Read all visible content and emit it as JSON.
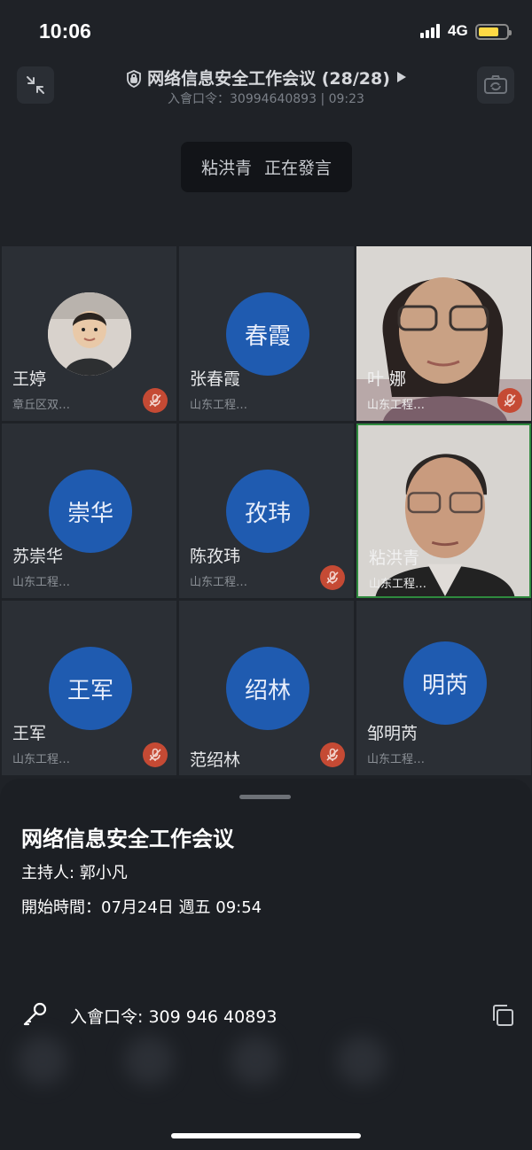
{
  "status_bar": {
    "time": "10:06",
    "network": "4G"
  },
  "header": {
    "title": "网络信息安全工作会议 (28/28)",
    "subtitle": "入會口令：30994640893 | 09:23",
    "speaking_name": "粘洪青",
    "speaking_status": "正在發言"
  },
  "participants": [
    {
      "name": "王婷",
      "org": "章丘区双…",
      "avatar_text": "",
      "muted": true,
      "video": false
    },
    {
      "name": "张春霞",
      "org": "山东工程…",
      "avatar_text": "春霞",
      "muted": false,
      "video": false
    },
    {
      "name": "叶 娜",
      "org": "山东工程…",
      "avatar_text": "",
      "muted": true,
      "video": true
    },
    {
      "name": "苏崇华",
      "org": "山东工程…",
      "avatar_text": "崇华",
      "muted": false,
      "video": false
    },
    {
      "name": "陈孜玮",
      "org": "山东工程…",
      "avatar_text": "孜玮",
      "muted": true,
      "video": false
    },
    {
      "name": "粘洪青",
      "org": "山东工程…",
      "avatar_text": "",
      "muted": false,
      "video": true
    },
    {
      "name": "王军",
      "org": "山东工程…",
      "avatar_text": "王军",
      "muted": true,
      "video": false
    },
    {
      "name": "范绍林",
      "org": "",
      "avatar_text": "绍林",
      "muted": true,
      "video": false
    },
    {
      "name": "邹明芮",
      "org": "山东工程…",
      "avatar_text": "明芮",
      "muted": false,
      "video": false
    }
  ],
  "sheet": {
    "title": "网络信息安全工作会议",
    "host": "主持人: 郭小凡",
    "start_time": "開始時間：07月24日 週五 09:54",
    "meeting_code": "入會口令: 309 946 40893"
  },
  "colors": {
    "avatar_blue": "#1f5bb0",
    "mute_red": "#c54a34",
    "active_green": "#2f8a3e"
  },
  "icons": {
    "collapse": "collapse-icon",
    "camera_switch": "camera-switch-icon",
    "shield": "shield-lock-icon",
    "key": "key-icon",
    "copy": "copy-icon",
    "mic_off": "mic-off-icon"
  }
}
